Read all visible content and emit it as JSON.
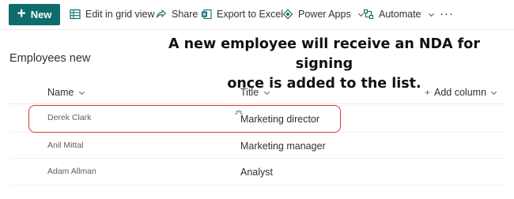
{
  "toolbar": {
    "new_label": "New",
    "edit_grid_label": "Edit in grid view",
    "share_label": "Share",
    "export_label": "Export to Excel",
    "power_apps_label": "Power Apps",
    "automate_label": "Automate",
    "more_label": "···"
  },
  "list": {
    "title": "Employees new",
    "columns": {
      "name": "Name",
      "title": "Title",
      "add_column": "Add column"
    },
    "rows": [
      {
        "name": "Derek Clark",
        "title": "Marketing director"
      },
      {
        "name": "Anil Mittal",
        "title": "Marketing manager"
      },
      {
        "name": "Adam Allman",
        "title": "Analyst"
      }
    ]
  },
  "annotation": {
    "line1": "A new employee will receive an NDA for signing",
    "line2": "once is added to the list."
  },
  "colors": {
    "accent": "#0f6c6c",
    "highlight": "#d43b3b"
  }
}
